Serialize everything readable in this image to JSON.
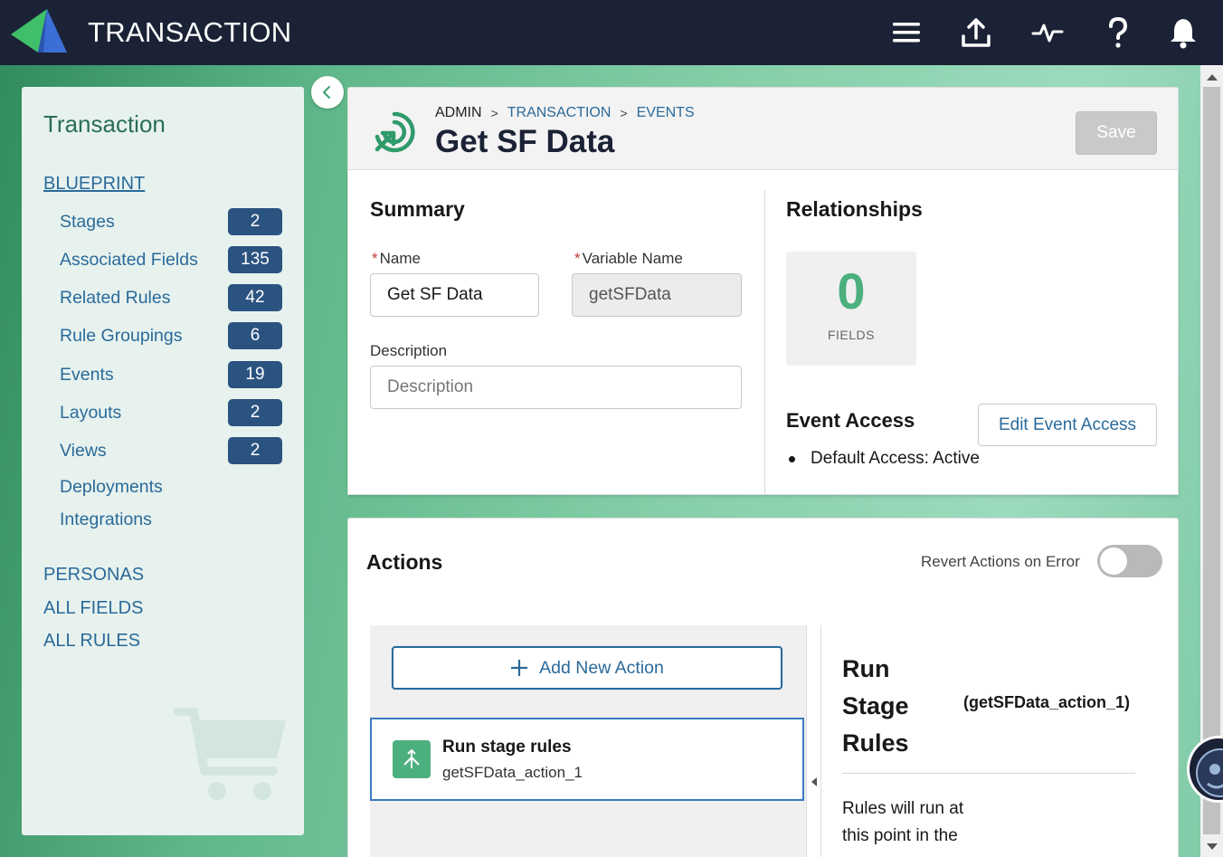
{
  "app": {
    "title": "TRANSACTION"
  },
  "topbar": {
    "icons": [
      "menu-icon",
      "upload-icon",
      "activity-icon",
      "help-icon",
      "bell-icon"
    ]
  },
  "sidebar": {
    "title": "Transaction",
    "blueprint_label": "BLUEPRINT",
    "items": [
      {
        "label": "Stages",
        "count": "2"
      },
      {
        "label": "Associated Fields",
        "count": "135"
      },
      {
        "label": "Related Rules",
        "count": "42"
      },
      {
        "label": "Rule Groupings",
        "count": "6"
      },
      {
        "label": "Events",
        "count": "19"
      },
      {
        "label": "Layouts",
        "count": "2"
      },
      {
        "label": "Views",
        "count": "2"
      },
      {
        "label": "Deployments"
      },
      {
        "label": "Integrations"
      }
    ],
    "sections": [
      "PERSONAS",
      "ALL FIELDS",
      "ALL RULES"
    ]
  },
  "header": {
    "breadcrumb": [
      "ADMIN",
      "TRANSACTION",
      "EVENTS"
    ],
    "title": "Get SF Data",
    "save_label": "Save"
  },
  "summary": {
    "heading": "Summary",
    "name_label": "Name",
    "name_value": "Get SF Data",
    "variable_label": "Variable Name",
    "variable_value": "getSFData",
    "description_label": "Description",
    "description_placeholder": "Description"
  },
  "relationships": {
    "heading": "Relationships",
    "fields_count": "0",
    "fields_label": "FIELDS"
  },
  "event_access": {
    "heading": "Event Access",
    "edit_label": "Edit Event Access",
    "items": [
      "Default Access: Active"
    ]
  },
  "actions": {
    "heading": "Actions",
    "revert_label": "Revert Actions on Error",
    "revert_on": false,
    "add_label": "Add New Action",
    "list": [
      {
        "title": "Run stage rules",
        "variable": "getSFData_action_1"
      }
    ],
    "detail": {
      "title": "Run Stage Rules",
      "variable": "(getSFData_action_1)",
      "description": "Rules will run at this point in the"
    }
  },
  "colors": {
    "topbar": "#1b2236",
    "accent_green": "#4caf7e",
    "link_blue": "#2a6a9a",
    "badge": "#2b5380"
  }
}
